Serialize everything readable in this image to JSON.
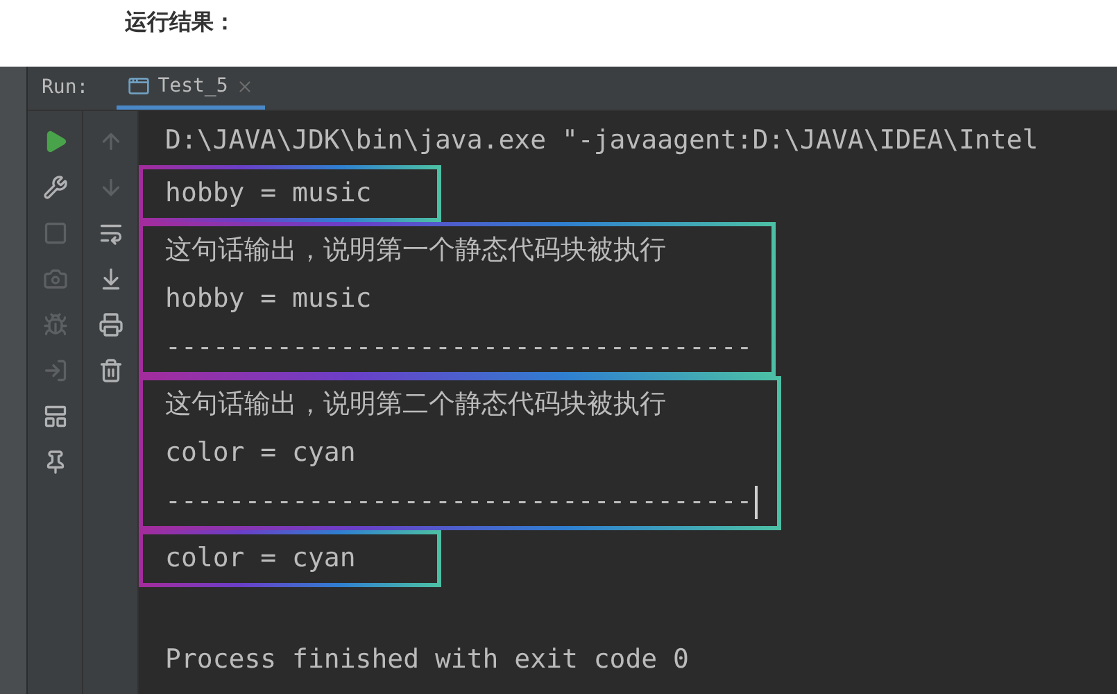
{
  "heading": "运行结果：",
  "run_panel": {
    "label": "Run:",
    "tabs": [
      {
        "label": "Test_5",
        "selected": true
      }
    ]
  },
  "left_toolbar": [
    {
      "disabled": false
    },
    {
      "disabled": false
    },
    {
      "disabled": true
    },
    {
      "disabled": true
    },
    {
      "disabled": true
    },
    {
      "disabled": true
    },
    {
      "disabled": false
    },
    {
      "disabled": false
    }
  ],
  "right_toolbar": [
    {
      "disabled": true
    },
    {
      "disabled": true
    },
    {
      "disabled": false
    },
    {
      "disabled": false
    },
    {
      "disabled": false
    },
    {
      "disabled": false
    }
  ],
  "console": [
    {
      "framed": false,
      "lines": [
        {
          "kind": "command",
          "text": "D:\\JAVA\\JDK\\bin\\java.exe \"-javaagent:D:\\JAVA\\IDEA\\Intel"
        }
      ]
    },
    {
      "framed": true,
      "lines": [
        {
          "kind": "output",
          "text": "hobby = music"
        }
      ]
    },
    {
      "framed": true,
      "lines": [
        {
          "kind": "output",
          "text": "这句话输出，说明第一个静态代码块被执行"
        },
        {
          "kind": "output",
          "text": "hobby = music"
        },
        {
          "kind": "output",
          "text": "-------------------------------------"
        }
      ]
    },
    {
      "framed": true,
      "lines": [
        {
          "kind": "output",
          "text": "这句话输出，说明第二个静态代码块被执行"
        },
        {
          "kind": "output",
          "text": "color = cyan"
        },
        {
          "kind": "caret",
          "text": "-------------------------------------"
        }
      ]
    },
    {
      "framed": true,
      "lines": [
        {
          "kind": "output",
          "text": "color = cyan"
        }
      ]
    },
    {
      "framed": false,
      "lines": [
        {
          "kind": "exit",
          "text": "Process finished with exit code 0"
        }
      ]
    }
  ]
}
